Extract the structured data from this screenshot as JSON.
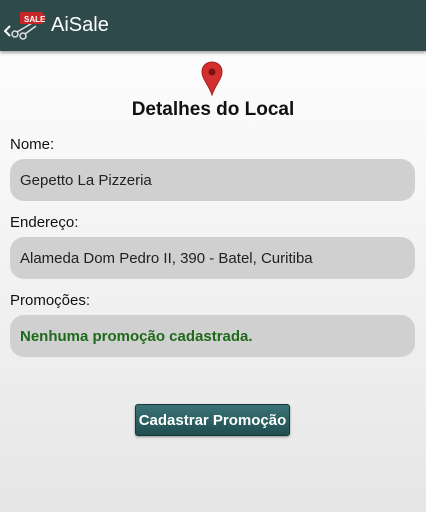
{
  "app": {
    "title": "AiSale",
    "logo_text": "SALE",
    "logo_icon": "back-logo-icon"
  },
  "colors": {
    "action_bar": "#2f4a4b",
    "pin": "#d32f2f",
    "field_bg": "#d0d0d0",
    "promo_text": "#1e6a1a",
    "button": "#2b6164"
  },
  "header": {
    "icon": "map-pin-icon",
    "title": "Detalhes do Local"
  },
  "fields": {
    "name_label": "Nome:",
    "name_value": "Gepetto La Pizzeria",
    "address_label": "Endereço:",
    "address_value": "Alameda Dom Pedro II, 390 - Batel, Curitiba",
    "promotions_label": "Promoções:",
    "promotions_value": "Nenhuma promoção cadastrada."
  },
  "actions": {
    "register_promotion": "Cadastrar Promoção"
  }
}
